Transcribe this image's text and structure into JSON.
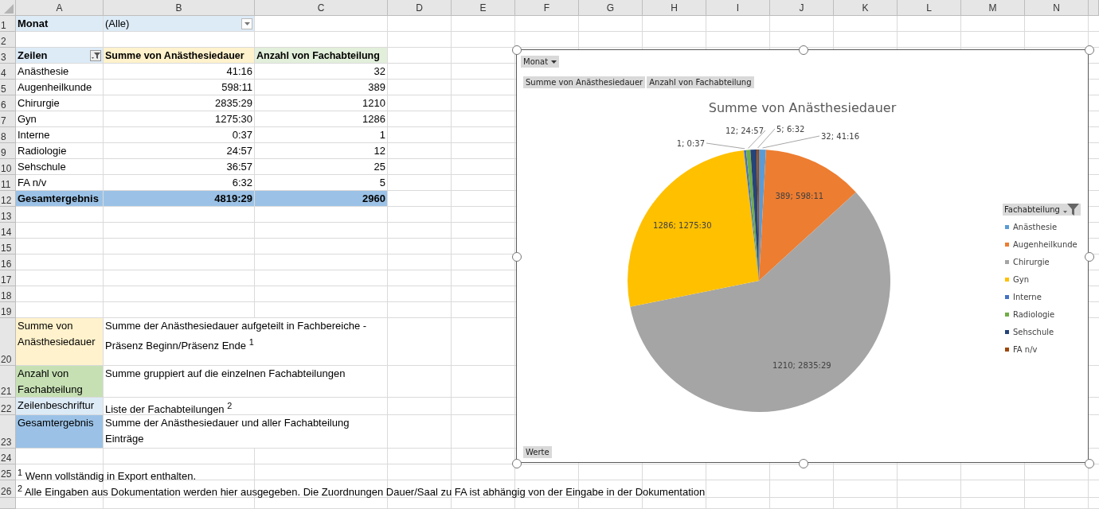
{
  "columns": [
    "A",
    "B",
    "C",
    "D",
    "E",
    "F",
    "G",
    "H",
    "I",
    "J",
    "K",
    "L",
    "M",
    "N"
  ],
  "row_numbers": [
    "1",
    "2",
    "3",
    "4",
    "5",
    "6",
    "7",
    "8",
    "9",
    "10",
    "11",
    "12",
    "13",
    "14",
    "15",
    "16",
    "17",
    "18",
    "19",
    "20",
    "21",
    "22",
    "23",
    "24",
    "25",
    "26"
  ],
  "report_filter": {
    "label": "Monat",
    "value": "(Alle)"
  },
  "pivot": {
    "row_header": "Zeilen",
    "value_headers": [
      "Summe von Anästhesiedauer",
      "Anzahl von Fachabteilung"
    ],
    "rows": [
      {
        "label": "Anästhesie",
        "sum": "41:16",
        "count": "32"
      },
      {
        "label": "Augenheilkunde",
        "sum": "598:11",
        "count": "389"
      },
      {
        "label": "Chirurgie",
        "sum": "2835:29",
        "count": "1210"
      },
      {
        "label": "Gyn",
        "sum": "1275:30",
        "count": "1286"
      },
      {
        "label": "Interne",
        "sum": "0:37",
        "count": "1"
      },
      {
        "label": "Radiologie",
        "sum": "24:57",
        "count": "12"
      },
      {
        "label": "Sehschule",
        "sum": "36:57",
        "count": "25"
      },
      {
        "label": "FA n/v",
        "sum": "6:32",
        "count": "5"
      }
    ],
    "total": {
      "label": "Gesamtergebnis",
      "sum": "4819:29",
      "count": "2960"
    }
  },
  "notes": [
    {
      "term": "Summe von Anästhesiedauer",
      "description": "Summe der Anästhesiedauer aufgeteilt in Fachbereiche - Präsenz Beginn/Präsenz Ende $^{1}$",
      "color": "#fff2cc"
    },
    {
      "term": "Anzahl von Fachabteilung",
      "description": "Summe gruppiert auf die einzelnen Fachabteilungen",
      "color": "#c6e0b4"
    },
    {
      "term": "Zeilenbeschriftur",
      "description": "Liste der Fachabteilungen $^{2}$",
      "color": "#ddebf7"
    },
    {
      "term": "Gesamtergebnis",
      "description": "Summe der Anästhesiedauer und aller Fachabteilung Einträge",
      "color": "#9bc2e6"
    }
  ],
  "footnotes": [
    "$^{1}$ Wenn vollständig in Export enthalten.",
    "$^{2}$ Alle Eingaben aus Dokumentation werden hier ausgegeben. Die Zuordnungen Dauer/Saal zu FA ist abhängig von der Eingabe in der Dokumentation"
  ],
  "chart": {
    "filter_button": "Monat",
    "value_buttons": [
      "Summe  von Anästhesiedauer",
      "Anzahl von Fachabteilung"
    ],
    "axis_button": "Werte",
    "chart_data": {
      "type": "pie",
      "title": "Summe von Anästhesiedauer",
      "categories": [
        "Anästhesie",
        "Augenheilkunde",
        "Chirurgie",
        "Gyn",
        "Interne",
        "Radiologie",
        "Sehschule",
        "FA n/v"
      ],
      "values": [
        0.856,
        12.412,
        58.833,
        26.466,
        0.013,
        0.518,
        0.767,
        0.135
      ]
    },
    "slice_labels": [
      "12; 24:57",
      "5; 6:32",
      "32; 41:16",
      "1; 0:37",
      "389; 598:11",
      "1286; 1275:30",
      "1210; 2835:29"
    ],
    "legend": {
      "title": "Fachabteilung",
      "items": [
        {
          "color": "#5b9bd5"
        },
        {
          "color": "#ed7d31"
        },
        {
          "color": "#a5a5a5"
        },
        {
          "color": "#ffc000"
        },
        {
          "color": "#4472c4"
        },
        {
          "color": "#70ad47"
        },
        {
          "color": "#264478"
        },
        {
          "color": "#9e480e"
        }
      ]
    }
  }
}
